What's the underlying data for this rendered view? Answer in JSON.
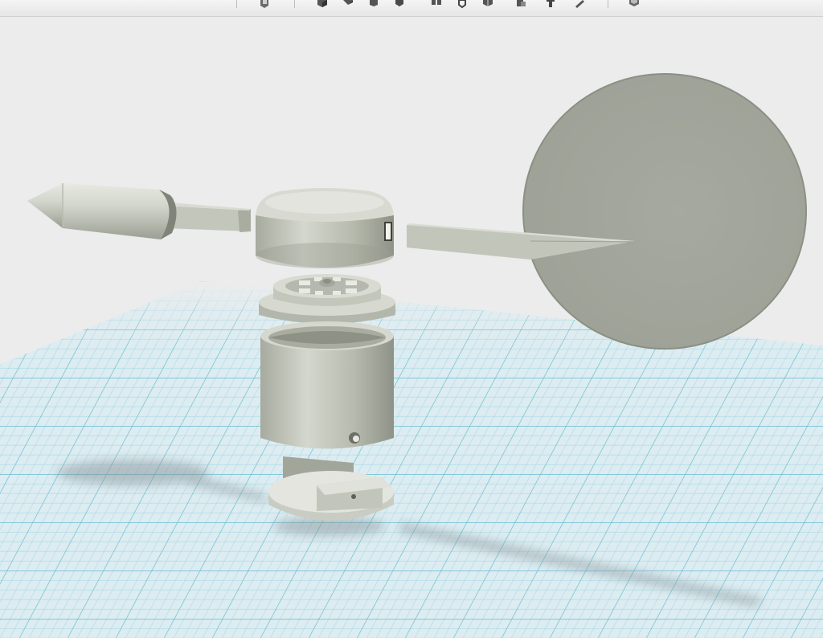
{
  "app": {
    "viewport": "3d-viewport"
  },
  "toolbar": {
    "groups": [
      {
        "name": "view-group",
        "icons": [
          "view-cube-icon"
        ]
      },
      {
        "name": "primitives-group",
        "icons": [
          "box-primitive-icon",
          "wedge-primitive-icon",
          "cylinder-primitive-icon",
          "sphere-primitive-icon",
          "multi-body-icon",
          "shell-icon",
          "split-icon",
          "combine-icon",
          "align-icon",
          "measure-icon"
        ]
      },
      {
        "name": "material-group",
        "icons": [
          "material-icon"
        ]
      }
    ]
  },
  "scene": {
    "model": "wind-vane-assembly",
    "parts": [
      "nose-cone",
      "nose-rod",
      "hub-cap",
      "tail-rod",
      "tail-fin-disc",
      "bearing-spacer",
      "housing-cylinder",
      "base-plate"
    ],
    "grid": {
      "visible": true,
      "line_color": "#8fd0e0",
      "background": "#dcecf1"
    },
    "model_color": "#c4c8bc",
    "background": "#ececec"
  }
}
